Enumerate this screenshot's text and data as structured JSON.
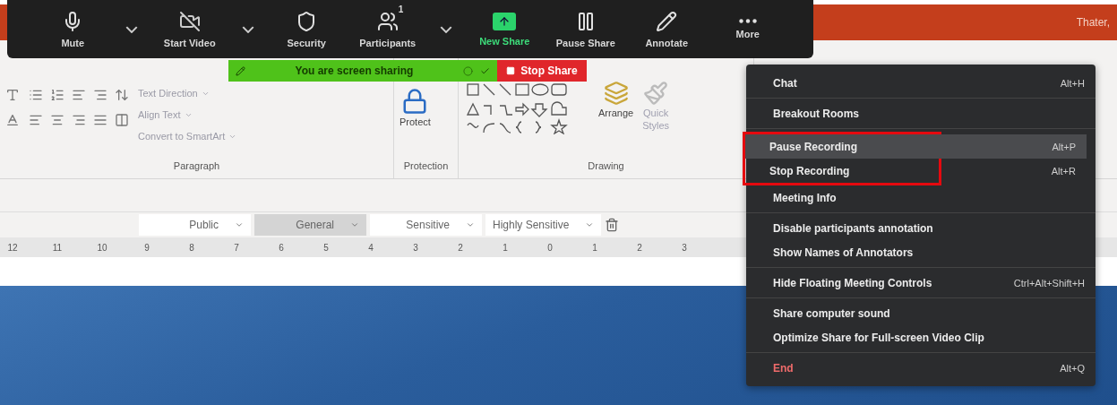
{
  "title_bar": {
    "user": "Thater,"
  },
  "meeting_toolbar": {
    "items": [
      {
        "kind": "button",
        "label": "Mute",
        "active": false
      },
      {
        "kind": "caret"
      },
      {
        "kind": "button",
        "label": "Start Video",
        "active": false
      },
      {
        "kind": "caret"
      },
      {
        "kind": "button",
        "label": "Security",
        "active": false
      },
      {
        "kind": "button",
        "label": "Participants",
        "badge": "1",
        "active": false
      },
      {
        "kind": "caret"
      },
      {
        "kind": "button",
        "label": "New Share",
        "active": true
      },
      {
        "kind": "button",
        "label": "Pause Share",
        "active": false
      },
      {
        "kind": "button",
        "label": "Annotate",
        "active": false
      },
      {
        "kind": "button",
        "label": "More",
        "active": false
      }
    ]
  },
  "sharing_banner": {
    "text": "You are screen sharing",
    "stop_label": "Stop Share"
  },
  "ribbon": {
    "paragraph": {
      "commands": [
        "Text Direction",
        "Align Text",
        "Convert to SmartArt"
      ],
      "label": "Paragraph"
    },
    "protection": {
      "button": "Protect",
      "label": "Protection"
    },
    "drawing": {
      "arrange": "Arrange",
      "quick_styles": [
        "Quick",
        "Styles"
      ],
      "label": "Drawing"
    }
  },
  "sensitivity_bar": {
    "options": [
      {
        "label": "Public",
        "selected": false
      },
      {
        "label": "General",
        "selected": true
      },
      {
        "label": "Sensitive",
        "selected": false
      },
      {
        "label": "Highly Sensitive",
        "selected": false
      }
    ]
  },
  "ruler": {
    "marks": [
      "12",
      "11",
      "10",
      "9",
      "8",
      "7",
      "6",
      "5",
      "4",
      "3",
      "2",
      "1",
      "0",
      "1",
      "2",
      "3"
    ]
  },
  "more_menu": {
    "groups": [
      {
        "items": [
          {
            "kind": "normal",
            "label": "Chat",
            "shortcut": "Alt+H",
            "selected": false,
            "highlighted": false
          }
        ]
      },
      {
        "items": [
          {
            "kind": "normal",
            "label": "Breakout Rooms",
            "selected": false,
            "highlighted": false
          }
        ]
      },
      {
        "items": [
          {
            "kind": "normal",
            "label": "Pause Recording",
            "shortcut": "Alt+P",
            "selected": true,
            "highlighted": true
          },
          {
            "kind": "normal",
            "label": "Stop Recording",
            "shortcut": "Alt+R",
            "selected": false,
            "highlighted": true
          },
          {
            "kind": "normal",
            "label": "Meeting Info",
            "selected": false,
            "highlighted": false
          }
        ]
      },
      {
        "items": [
          {
            "kind": "normal",
            "label": "Disable participants annotation",
            "selected": false,
            "highlighted": false
          },
          {
            "kind": "normal",
            "label": "Show Names of Annotators",
            "selected": false,
            "highlighted": false
          }
        ]
      },
      {
        "items": [
          {
            "kind": "normal",
            "label": "Hide Floating Meeting Controls",
            "shortcut": "Ctrl+Alt+Shift+H",
            "selected": false,
            "highlighted": false
          }
        ]
      },
      {
        "items": [
          {
            "kind": "normal",
            "label": "Share computer sound",
            "selected": false,
            "highlighted": false
          },
          {
            "kind": "normal",
            "label": "Optimize Share for Full-screen Video Clip",
            "selected": false,
            "highlighted": false
          }
        ]
      },
      {
        "items": [
          {
            "kind": "danger",
            "label": "End",
            "shortcut": "Alt+Q",
            "selected": false,
            "highlighted": false
          }
        ]
      }
    ]
  }
}
